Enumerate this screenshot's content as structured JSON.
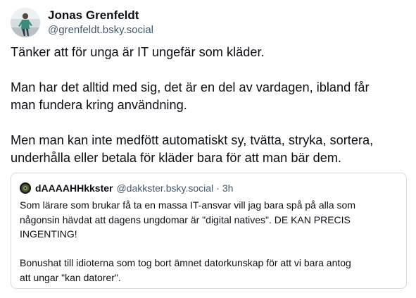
{
  "post": {
    "author": {
      "display_name": "Jonas Grenfeldt",
      "handle": "@grenfeldt.bsky.social",
      "avatar_icon": "person-photo-avatar-icon"
    },
    "paragraphs": [
      {
        "lines": [
          "Tänker att för unga är IT ungefär som kläder."
        ]
      },
      {
        "lines": [
          "Man har det alltid med sig, det är en del av vardagen, ibland får",
          "man fundera kring användning."
        ]
      },
      {
        "lines": [
          "Men man kan inte medfött automatiskt sy, tvätta, stryka, sortera,",
          "underhålla eller betala för kläder bara för att man bär dem."
        ]
      }
    ],
    "quote": {
      "author": {
        "display_name": "dAAAAHHkkster",
        "handle": "@dakkster.bsky.social",
        "avatar_icon": "dark-avatar-icon"
      },
      "separator": "·",
      "time": "3h",
      "paragraphs": [
        {
          "lines": [
            "Som lärare som brukar få ta en massa IT-ansvar vill jag bara spå på alla som",
            "någonsin hävdat att dagens ungdomar är \"digital natives\". DE KAN PRECIS",
            "INGENTING!"
          ]
        },
        {
          "lines": [
            "Bonushat till idioterna som tog bort ämnet datorkunskap för att vi bara antog",
            "att ungar \"kan datorer\"."
          ]
        }
      ]
    }
  },
  "colors": {
    "text": "#0b0f14",
    "muted": "#42576c",
    "border": "#d4dbe2",
    "background": "#ffffff"
  }
}
